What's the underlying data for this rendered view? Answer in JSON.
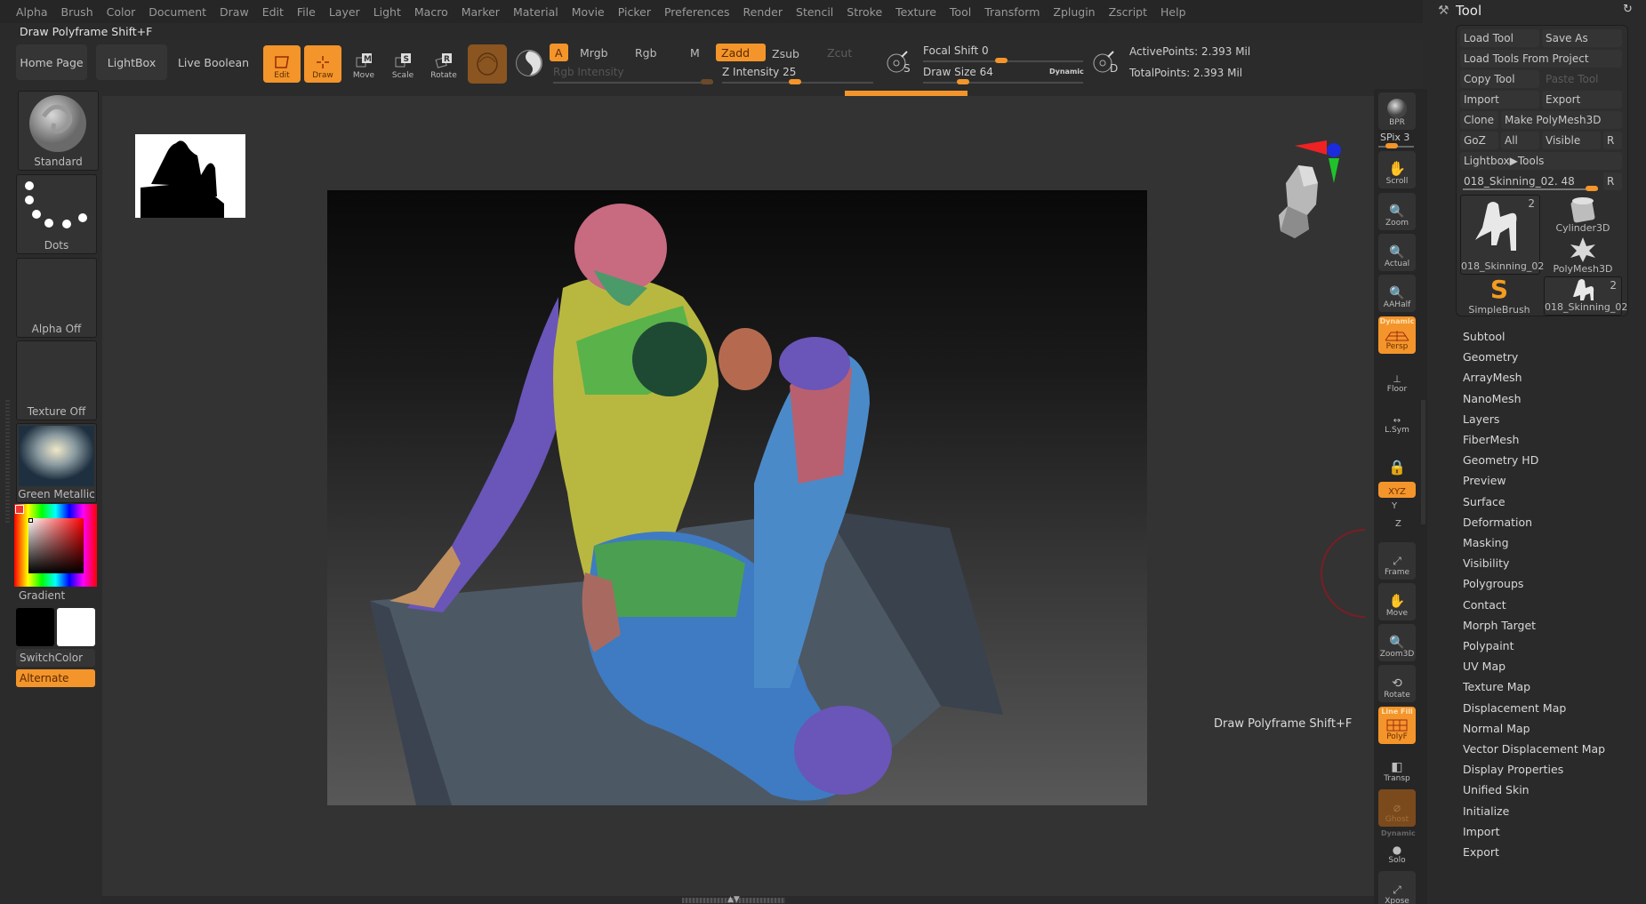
{
  "menu": [
    "Alpha",
    "Brush",
    "Color",
    "Document",
    "Draw",
    "Edit",
    "File",
    "Layer",
    "Light",
    "Macro",
    "Marker",
    "Material",
    "Movie",
    "Picker",
    "Preferences",
    "Render",
    "Stencil",
    "Stroke",
    "Texture",
    "Tool",
    "Transform",
    "Zplugin",
    "Zscript",
    "Help"
  ],
  "status_line": "Draw Polyframe Shift+F",
  "toolbar": {
    "home_page": "Home Page",
    "lightbox": "LightBox",
    "live_boolean": "Live Boolean",
    "edit": "Edit",
    "draw": "Draw",
    "move": "Move",
    "scale": "Scale",
    "rotate": "Rotate",
    "a": "A",
    "mrgb": "Mrgb",
    "rgb": "Rgb",
    "m": "M",
    "zadd": "Zadd",
    "zsub": "Zsub",
    "zcut": "Zcut",
    "rgb_intensity_label": "Rgb Intensity",
    "z_intensity_label": "Z Intensity 25",
    "z_intensity": 25,
    "focal_shift_label": "Focal Shift 0",
    "focal_shift": 0,
    "draw_size_label": "Draw Size 64",
    "draw_size": 64,
    "dynamic": "Dynamic",
    "s_label": "S",
    "d_label": "D",
    "active_points": "ActivePoints: 2.393 Mil",
    "total_points": "TotalPoints: 2.393 Mil"
  },
  "left_shelf": {
    "brush": "Standard",
    "stroke": "Dots",
    "alpha": "Alpha Off",
    "texture": "Texture Off",
    "material": "Green Metallic",
    "gradient": "Gradient",
    "switch_color": "SwitchColor",
    "alternate": "Alternate"
  },
  "right_shelf": {
    "bpr": "BPR",
    "spix": "SPix 3",
    "scroll": "Scroll",
    "zoom": "Zoom",
    "actual": "Actual",
    "aahalf": "AAHalf",
    "persp_tag": "Dynamic",
    "persp": "Persp",
    "floor": "Floor",
    "lsym": "L.Sym",
    "xyz": "XYZ",
    "y": "Y",
    "z": "Z",
    "frame": "Frame",
    "move": "Move",
    "zoom3d": "Zoom3D",
    "rotate": "Rotate",
    "polyf_tag": "Line Fill",
    "polyf": "PolyF",
    "transp": "Transp",
    "ghost": "Ghost",
    "solo_tag": "Dynamic",
    "solo": "Solo",
    "xpose": "Xpose"
  },
  "tooltip": "Draw Polyframe  Shift+F",
  "tool_panel": {
    "title": "Tool",
    "load_tool": "Load Tool",
    "save_as": "Save As",
    "load_from_project": "Load Tools From Project",
    "copy_tool": "Copy Tool",
    "paste_tool": "Paste Tool",
    "import": "Import",
    "export": "Export",
    "clone": "Clone",
    "make_polymesh": "Make PolyMesh3D",
    "goz": "GoZ",
    "all": "All",
    "visible": "Visible",
    "r": "R",
    "lightbox_tools": "Lightbox▶Tools",
    "current_tool": "018_Skinning_02. 48",
    "thumbs": [
      {
        "label": "018_Skinning_02",
        "count": "2"
      },
      {
        "label": "Cylinder3D",
        "count": ""
      },
      {
        "label": "PolyMesh3D",
        "count": ""
      },
      {
        "label": "SimpleBrush",
        "count": ""
      },
      {
        "label": "018_Skinning_02",
        "count": "2"
      }
    ],
    "sections": [
      "Subtool",
      "Geometry",
      "ArrayMesh",
      "NanoMesh",
      "Layers",
      "FiberMesh",
      "Geometry HD",
      "Preview",
      "Surface",
      "Deformation",
      "Masking",
      "Visibility",
      "Polygroups",
      "Contact",
      "Morph Target",
      "Polypaint",
      "UV Map",
      "Texture Map",
      "Displacement Map",
      "Normal Map",
      "Vector Displacement Map",
      "Display Properties",
      "Unified Skin",
      "Initialize",
      "Import",
      "Export"
    ]
  },
  "colors": {
    "accent": "#f3952a",
    "bg": "#2a2a2a",
    "canvas": "#333333"
  }
}
